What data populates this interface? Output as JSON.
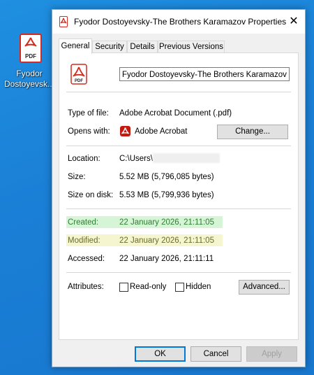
{
  "desktop": {
    "icon_label": "Fyodor\nDostoyevsk...",
    "icon_label_line1": "Fyodor",
    "icon_label_line2": "Dostoyevsk..."
  },
  "window": {
    "title": "Fyodor Dostoyevsky-The Brothers Karamazov Properties",
    "close_glyph": "✕"
  },
  "tabs": [
    "General",
    "Security",
    "Details",
    "Previous Versions"
  ],
  "general": {
    "file_name": "Fyodor Dostoyevsky-The Brothers Karamazov",
    "pdf_icon_text": "PDF",
    "type_label": "Type of file:",
    "type_value": "Adobe Acrobat Document (.pdf)",
    "opens_label": "Opens with:",
    "opens_value": "Adobe Acrobat",
    "change_button": "Change...",
    "location_label": "Location:",
    "location_value": "C:\\Users\\",
    "size_label": "Size:",
    "size_value": "5.52 MB (5,796,085 bytes)",
    "size_on_disk_label": "Size on disk:",
    "size_on_disk_value": "5.53 MB (5,799,936 bytes)",
    "created_label": "Created:",
    "created_value": "22 January 2026, 21:11:05",
    "modified_label": "Modified:",
    "modified_value": "22 January 2026, 21:11:05",
    "accessed_label": "Accessed:",
    "accessed_value": "22 January 2026, 21:11:11",
    "attributes_label": "Attributes:",
    "readonly_label": "Read-only",
    "hidden_label": "Hidden",
    "advanced_button": "Advanced..."
  },
  "footer": {
    "ok": "OK",
    "cancel": "Cancel",
    "apply": "Apply"
  },
  "colors": {
    "created_highlight": "#d6f5d6",
    "modified_highlight": "#f5f5d0",
    "pdf_red": "#d42a1f",
    "desktop_bg": "#1a7fd6"
  }
}
